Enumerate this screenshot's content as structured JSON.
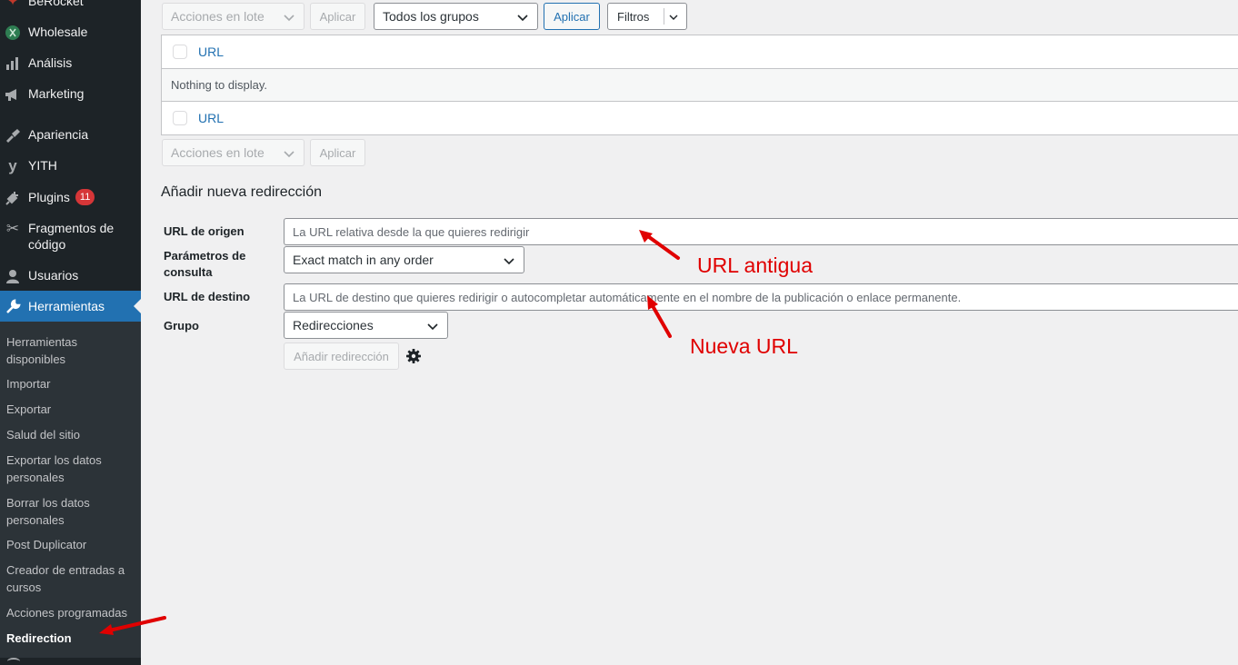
{
  "sidebar": {
    "items": [
      {
        "label": "BeRocket",
        "icon": "rocket-icon"
      },
      {
        "label": "Wholesale",
        "icon": "wholesale-icon"
      },
      {
        "label": "Análisis",
        "icon": "bar-chart-icon"
      },
      {
        "label": "Marketing",
        "icon": "megaphone-icon"
      },
      {
        "label": "Apariencia",
        "icon": "paintbrush-icon"
      },
      {
        "label": "YITH",
        "icon": "yith-icon"
      },
      {
        "label": "Plugins",
        "icon": "plugin-icon",
        "badge": "11"
      },
      {
        "label": "Fragmentos de código",
        "icon": "scissors-icon"
      },
      {
        "label": "Usuarios",
        "icon": "user-icon"
      },
      {
        "label": "Herramientas",
        "icon": "wrench-icon"
      }
    ],
    "submenu": [
      "Herramientas disponibles",
      "Importar",
      "Exportar",
      "Salud del sitio",
      "Exportar los datos personales",
      "Borrar los datos personales",
      "Post Duplicator",
      "Creador de entradas a cursos",
      "Acciones programadas",
      "Redirection"
    ]
  },
  "toolbar": {
    "bulk_actions": "Acciones en lote",
    "apply": "Aplicar",
    "groups_select": "Todos los grupos",
    "apply_group": "Aplicar",
    "filters": "Filtros"
  },
  "table": {
    "header_col": "URL",
    "empty": "Nothing to display.",
    "footer_col": "URL"
  },
  "bottom_toolbar": {
    "bulk_actions": "Acciones en lote",
    "apply": "Aplicar"
  },
  "form": {
    "title": "Añadir nueva redirección",
    "source_label": "URL de origen",
    "source_placeholder": "La URL relativa desde la que quieres redirigir",
    "query_label": "Parámetros de consulta",
    "query_value": "Exact match in any order",
    "target_label": "URL de destino",
    "target_placeholder": "La URL de destino que quieres redirigir o autocompletar automáticamente en el nombre de la publicación o enlace permanente.",
    "group_label": "Grupo",
    "group_value": "Redirecciones",
    "submit": "Añadir redirección"
  },
  "annotations": {
    "old_url": "URL antigua",
    "new_url": "Nueva URL"
  },
  "colors": {
    "sidebar_bg": "#1d2327",
    "accent": "#2271b1",
    "annotation": "#e00000"
  }
}
